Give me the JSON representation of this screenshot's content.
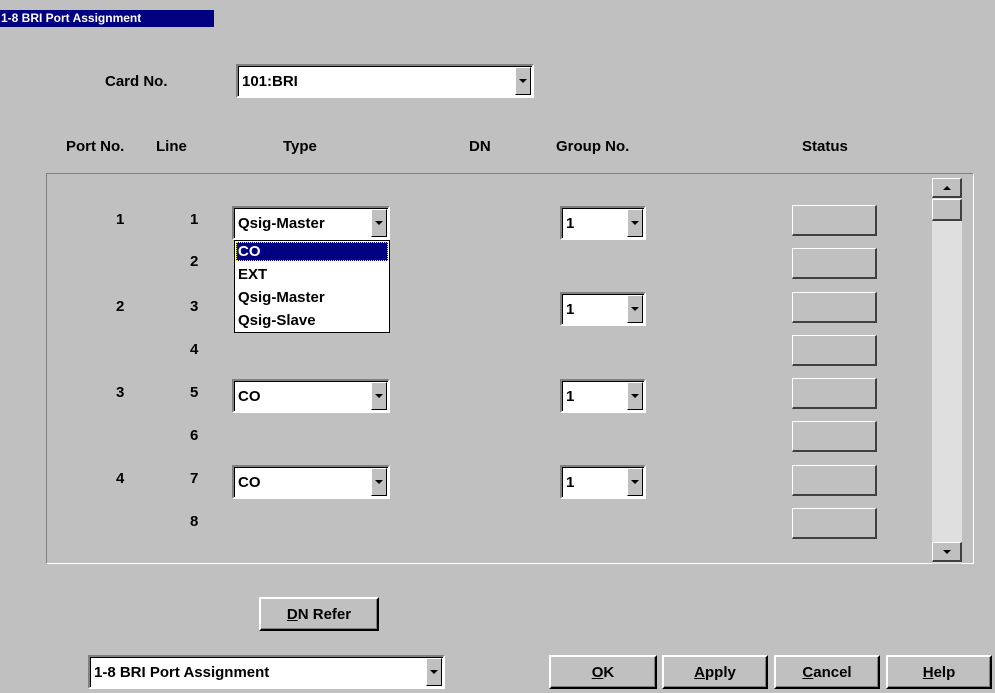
{
  "window": {
    "title": "1-8 BRI Port Assignment"
  },
  "card": {
    "label": "Card No.",
    "value": "101:BRI"
  },
  "columns": {
    "port": "Port No.",
    "line": "Line",
    "type": "Type",
    "dn": "DN",
    "group": "Group No.",
    "status": "Status"
  },
  "ports": [
    "1",
    "2",
    "3",
    "4"
  ],
  "lines": [
    "1",
    "2",
    "3",
    "4",
    "5",
    "6",
    "7",
    "8"
  ],
  "types": [
    "Qsig-Master",
    "CO",
    "CO"
  ],
  "groups": [
    "1",
    "1",
    "1",
    "1"
  ],
  "type_options": [
    "CO",
    "EXT",
    "Qsig-Master",
    "Qsig-Slave"
  ],
  "buttons": {
    "dn_refer": {
      "underline": "D",
      "rest": "N Refer"
    },
    "ok": {
      "underline": "O",
      "rest": "K"
    },
    "apply": {
      "underline": "A",
      "rest": "pply"
    },
    "cancel": {
      "underline": "C",
      "rest": "ancel"
    },
    "help": {
      "underline": "H",
      "rest": "elp"
    }
  },
  "screen_select": {
    "value": "1-8 BRI Port Assignment"
  },
  "colors": {
    "face": "#c0c0c0",
    "titlebar": "#000080",
    "selection": "#000080"
  }
}
